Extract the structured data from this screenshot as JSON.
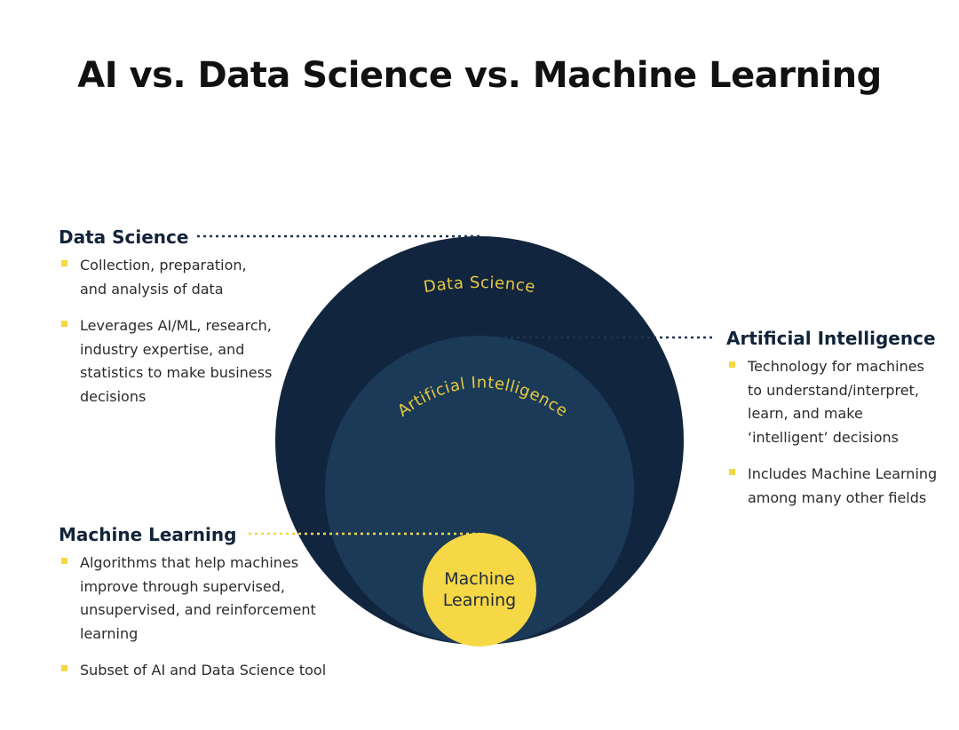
{
  "title": "AI vs. Data Science vs. Machine Learning",
  "colors": {
    "outer_circle": "#12253f",
    "middle_circle": "#1a3a58",
    "inner_circle": "#f6d745",
    "arc_text": "#e8c93e",
    "bullet_marker": "#f6d745",
    "connector_dark": "#1b3550",
    "connector_yellow": "#f2d64c"
  },
  "diagram": {
    "outer_label": "Data Science",
    "middle_label": "Artificial Intelligence",
    "inner_label_line1": "Machine",
    "inner_label_line2": "Learning"
  },
  "sections": {
    "data_science": {
      "heading": "Data Science",
      "bullets": [
        {
          "line1": "Collection, preparation,",
          "line2": "and analysis of data"
        },
        {
          "line1": "Leverages AI/ML, research,",
          "line2": "industry expertise, and",
          "line3": "statistics to make business",
          "line4": "decisions"
        }
      ]
    },
    "artificial_intelligence": {
      "heading": "Artificial Intelligence",
      "bullets": [
        {
          "line1": "Technology for machines",
          "line2": "to understand/interpret,",
          "line3": "learn, and make",
          "line4": "‘intelligent’ decisions"
        },
        {
          "line1": "Includes Machine Learning",
          "line2": "among many other fields"
        }
      ]
    },
    "machine_learning": {
      "heading": "Machine Learning",
      "bullets": [
        {
          "line1": "Algorithms that help machines",
          "line2": "improve  through supervised,",
          "line3": "unsupervised, and reinforcement",
          "line4": "learning"
        },
        {
          "line1": "Subset of AI and Data Science tool"
        }
      ]
    }
  }
}
